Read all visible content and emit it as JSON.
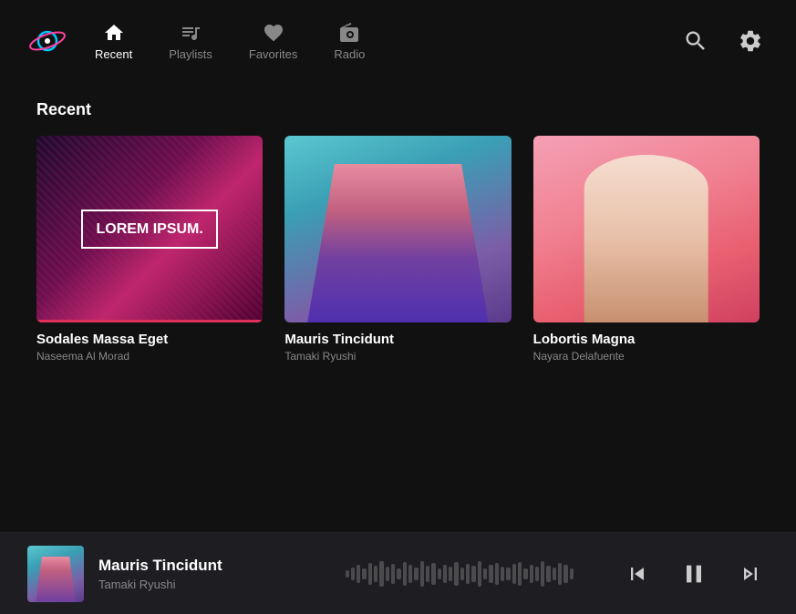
{
  "app": {
    "logo_alt": "Music App Logo"
  },
  "nav": {
    "items": [
      {
        "id": "recent",
        "label": "Recent",
        "icon": "home",
        "active": true
      },
      {
        "id": "playlists",
        "label": "Playlists",
        "icon": "playlist",
        "active": false
      },
      {
        "id": "favorites",
        "label": "Favorites",
        "icon": "heart",
        "active": false
      },
      {
        "id": "radio",
        "label": "Radio",
        "icon": "radio",
        "active": false
      }
    ],
    "search_label": "Search",
    "settings_label": "Settings"
  },
  "main": {
    "section_title": "Recent",
    "cards": [
      {
        "id": "card1",
        "title": "Sodales Massa Eget",
        "artist": "Naseema Al Morad",
        "image_type": "abstract",
        "lorem": "LOREM\nIPSUM.",
        "active": true
      },
      {
        "id": "card2",
        "title": "Mauris Tincidunt",
        "artist": "Tamaki Ryushi",
        "image_type": "person_pink",
        "active": false
      },
      {
        "id": "card3",
        "title": "Lobortis Magna",
        "artist": "Nayara Delafuente",
        "image_type": "person_white",
        "active": false
      }
    ]
  },
  "player": {
    "track_title": "Mauris Tincidunt",
    "track_artist": "Tamaki Ryushi",
    "controls": {
      "prev_label": "Previous",
      "play_label": "Pause",
      "next_label": "Next"
    }
  }
}
